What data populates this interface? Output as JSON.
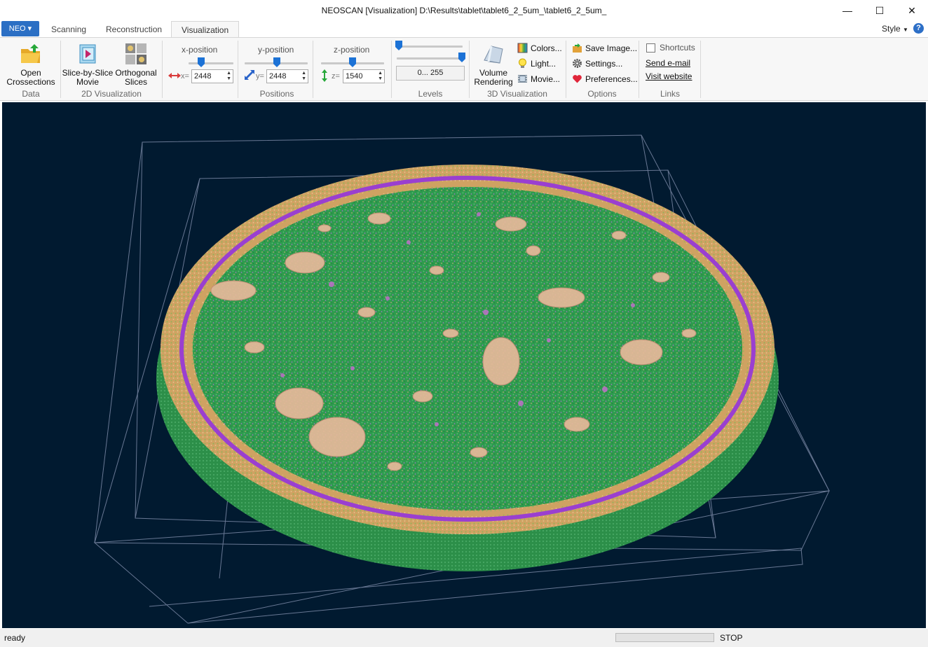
{
  "window": {
    "title": "NEOSCAN [Visualization] D:\\Results\\tablet\\tablet6_2_5um_\\tablet6_2_5um_",
    "minimize": "—",
    "maximize": "☐",
    "close": "✕"
  },
  "tabs": {
    "app_button": "NEO",
    "items": [
      "Scanning",
      "Reconstruction",
      "Visualization"
    ],
    "active": "Visualization",
    "style_menu": "Style",
    "help": "?"
  },
  "ribbon": {
    "data": {
      "open_label": "Open\nCrossections",
      "group_label": "Data"
    },
    "visualization2d": {
      "slice_label": "Slice-by-Slice\nMovie",
      "ortho_label": "Orthogonal\nSlices",
      "group_label": "2D Visualization"
    },
    "positions": {
      "x_label": "x-position",
      "y_label": "y-position",
      "z_label": "z-position",
      "x_prefix": "x=",
      "y_prefix": "y=",
      "z_prefix": "z=",
      "x_value": "2448",
      "y_value": "2448",
      "z_value": "1540",
      "group_label": "Positions"
    },
    "levels": {
      "range": "0... 255",
      "low_fraction": 0.0,
      "high_fraction": 1.0,
      "group_label": "Levels"
    },
    "visualization3d": {
      "volume_label": "Volume\nRendering",
      "colors_label": "Colors...",
      "light_label": "Light...",
      "movie_label": "Movie...",
      "group_label": "3D Visualization"
    },
    "options": {
      "save_label": "Save Image...",
      "settings_label": "Settings...",
      "preferences_label": "Preferences...",
      "group_label": "Options"
    },
    "links": {
      "shortcuts_label": "Shortcuts",
      "email_label": "Send e-mail",
      "website_label": "Visit website",
      "group_label": "Links"
    }
  },
  "status": {
    "text": "ready",
    "stop_label": "STOP",
    "progress_fraction": 0.0
  },
  "colors": {
    "viewport_bg": "#011a30",
    "accent": "#1c72d6",
    "tablet_green": "#2a9a4c",
    "tablet_purple": "#9a3fd0",
    "tablet_orange": "#d4a062"
  }
}
